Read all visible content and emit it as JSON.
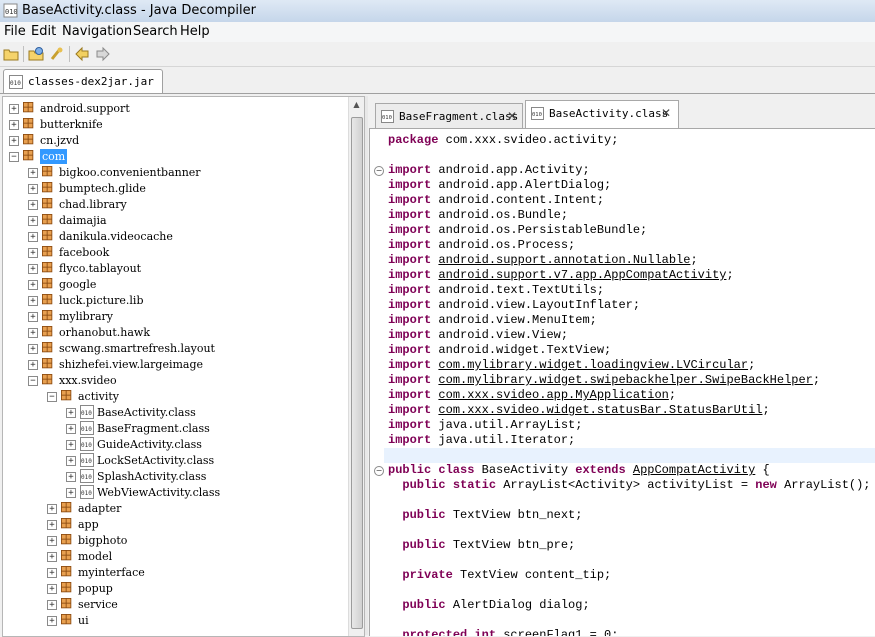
{
  "window": {
    "title": "BaseActivity.class - Java Decompiler"
  },
  "menu": [
    "File",
    "Edit",
    "Navigation",
    "Search",
    "Help"
  ],
  "file_tab": {
    "label": "classes-dex2jar.jar"
  },
  "tree": [
    {
      "label": "android.support",
      "depth": 0,
      "toggle": "+",
      "kind": "pkg"
    },
    {
      "label": "butterknife",
      "depth": 0,
      "toggle": "+",
      "kind": "pkg"
    },
    {
      "label": "cn.jzvd",
      "depth": 0,
      "toggle": "+",
      "kind": "pkg"
    },
    {
      "label": "com",
      "depth": 0,
      "toggle": "−",
      "kind": "pkg",
      "selected": true
    },
    {
      "label": "bigkoo.convenientbanner",
      "depth": 1,
      "toggle": "+",
      "kind": "pkg"
    },
    {
      "label": "bumptech.glide",
      "depth": 1,
      "toggle": "+",
      "kind": "pkg"
    },
    {
      "label": "chad.library",
      "depth": 1,
      "toggle": "+",
      "kind": "pkg"
    },
    {
      "label": "daimajia",
      "depth": 1,
      "toggle": "+",
      "kind": "pkg"
    },
    {
      "label": "danikula.videocache",
      "depth": 1,
      "toggle": "+",
      "kind": "pkg"
    },
    {
      "label": "facebook",
      "depth": 1,
      "toggle": "+",
      "kind": "pkg"
    },
    {
      "label": "flyco.tablayout",
      "depth": 1,
      "toggle": "+",
      "kind": "pkg"
    },
    {
      "label": "google",
      "depth": 1,
      "toggle": "+",
      "kind": "pkg"
    },
    {
      "label": "luck.picture.lib",
      "depth": 1,
      "toggle": "+",
      "kind": "pkg"
    },
    {
      "label": "mylibrary",
      "depth": 1,
      "toggle": "+",
      "kind": "pkg"
    },
    {
      "label": "orhanobut.hawk",
      "depth": 1,
      "toggle": "+",
      "kind": "pkg"
    },
    {
      "label": "scwang.smartrefresh.layout",
      "depth": 1,
      "toggle": "+",
      "kind": "pkg"
    },
    {
      "label": "shizhefei.view.largeimage",
      "depth": 1,
      "toggle": "+",
      "kind": "pkg"
    },
    {
      "label": "xxx.svideo",
      "depth": 1,
      "toggle": "−",
      "kind": "pkg"
    },
    {
      "label": "activity",
      "depth": 2,
      "toggle": "−",
      "kind": "pkg"
    },
    {
      "label": "BaseActivity.class",
      "depth": 3,
      "toggle": "+",
      "kind": "cls"
    },
    {
      "label": "BaseFragment.class",
      "depth": 3,
      "toggle": "+",
      "kind": "cls"
    },
    {
      "label": "GuideActivity.class",
      "depth": 3,
      "toggle": "+",
      "kind": "cls"
    },
    {
      "label": "LockSetActivity.class",
      "depth": 3,
      "toggle": "+",
      "kind": "cls"
    },
    {
      "label": "SplashActivity.class",
      "depth": 3,
      "toggle": "+",
      "kind": "cls"
    },
    {
      "label": "WebViewActivity.class",
      "depth": 3,
      "toggle": "+",
      "kind": "cls"
    },
    {
      "label": "adapter",
      "depth": 2,
      "toggle": "+",
      "kind": "pkg"
    },
    {
      "label": "app",
      "depth": 2,
      "toggle": "+",
      "kind": "pkg"
    },
    {
      "label": "bigphoto",
      "depth": 2,
      "toggle": "+",
      "kind": "pkg"
    },
    {
      "label": "model",
      "depth": 2,
      "toggle": "+",
      "kind": "pkg"
    },
    {
      "label": "myinterface",
      "depth": 2,
      "toggle": "+",
      "kind": "pkg"
    },
    {
      "label": "popup",
      "depth": 2,
      "toggle": "+",
      "kind": "pkg"
    },
    {
      "label": "service",
      "depth": 2,
      "toggle": "+",
      "kind": "pkg"
    },
    {
      "label": "ui",
      "depth": 2,
      "toggle": "+",
      "kind": "pkg"
    }
  ],
  "code_tabs": [
    {
      "label": "BaseFragment.class",
      "active": false
    },
    {
      "label": "BaseActivity.class",
      "active": true
    }
  ],
  "code": [
    {
      "line": 0,
      "parts": [
        [
          "kw",
          "package"
        ],
        [
          "t",
          " com.xxx.svideo.activity;"
        ]
      ]
    },
    {
      "line": 2,
      "fold": true,
      "parts": [
        [
          "kw",
          "import"
        ],
        [
          "t",
          " android.app.Activity;"
        ]
      ]
    },
    {
      "line": 3,
      "parts": [
        [
          "kw",
          "import"
        ],
        [
          "t",
          " android.app.AlertDialog;"
        ]
      ]
    },
    {
      "line": 4,
      "parts": [
        [
          "kw",
          "import"
        ],
        [
          "t",
          " android.content.Intent;"
        ]
      ]
    },
    {
      "line": 5,
      "parts": [
        [
          "kw",
          "import"
        ],
        [
          "t",
          " android.os.Bundle;"
        ]
      ]
    },
    {
      "line": 6,
      "parts": [
        [
          "kw",
          "import"
        ],
        [
          "t",
          " android.os.PersistableBundle;"
        ]
      ]
    },
    {
      "line": 7,
      "parts": [
        [
          "kw",
          "import"
        ],
        [
          "t",
          " android.os.Process;"
        ]
      ]
    },
    {
      "line": 8,
      "parts": [
        [
          "kw",
          "import"
        ],
        [
          "t",
          " "
        ],
        [
          "u",
          "android.support.annotation.Nullable"
        ],
        [
          "t",
          ";"
        ]
      ]
    },
    {
      "line": 9,
      "parts": [
        [
          "kw",
          "import"
        ],
        [
          "t",
          " "
        ],
        [
          "u",
          "android.support.v7.app.AppCompatActivity"
        ],
        [
          "t",
          ";"
        ]
      ]
    },
    {
      "line": 10,
      "parts": [
        [
          "kw",
          "import"
        ],
        [
          "t",
          " android.text.TextUtils;"
        ]
      ]
    },
    {
      "line": 11,
      "parts": [
        [
          "kw",
          "import"
        ],
        [
          "t",
          " android.view.LayoutInflater;"
        ]
      ]
    },
    {
      "line": 12,
      "parts": [
        [
          "kw",
          "import"
        ],
        [
          "t",
          " android.view.MenuItem;"
        ]
      ]
    },
    {
      "line": 13,
      "parts": [
        [
          "kw",
          "import"
        ],
        [
          "t",
          " android.view.View;"
        ]
      ]
    },
    {
      "line": 14,
      "parts": [
        [
          "kw",
          "import"
        ],
        [
          "t",
          " android.widget.TextView;"
        ]
      ]
    },
    {
      "line": 15,
      "parts": [
        [
          "kw",
          "import"
        ],
        [
          "t",
          " "
        ],
        [
          "u",
          "com.mylibrary.widget.loadingview.LVCircular"
        ],
        [
          "t",
          ";"
        ]
      ]
    },
    {
      "line": 16,
      "parts": [
        [
          "kw",
          "import"
        ],
        [
          "t",
          " "
        ],
        [
          "u",
          "com.mylibrary.widget.swipebackhelper.SwipeBackHelper"
        ],
        [
          "t",
          ";"
        ]
      ]
    },
    {
      "line": 17,
      "parts": [
        [
          "kw",
          "import"
        ],
        [
          "t",
          " "
        ],
        [
          "u",
          "com.xxx.svideo.app.MyApplication"
        ],
        [
          "t",
          ";"
        ]
      ]
    },
    {
      "line": 18,
      "parts": [
        [
          "kw",
          "import"
        ],
        [
          "t",
          " "
        ],
        [
          "u",
          "com.xxx.svideo.widget.statusBar.StatusBarUtil"
        ],
        [
          "t",
          ";"
        ]
      ]
    },
    {
      "line": 19,
      "parts": [
        [
          "kw",
          "import"
        ],
        [
          "t",
          " java.util.ArrayList;"
        ]
      ]
    },
    {
      "line": 20,
      "parts": [
        [
          "kw",
          "import"
        ],
        [
          "t",
          " java.util.Iterator;"
        ]
      ]
    },
    {
      "line": 22,
      "fold": true,
      "parts": [
        [
          "kw",
          "public class"
        ],
        [
          "t",
          " BaseActivity "
        ],
        [
          "kw",
          "extends"
        ],
        [
          "t",
          " "
        ],
        [
          "u",
          "AppCompatActivity"
        ],
        [
          "t",
          " {"
        ]
      ]
    },
    {
      "line": 23,
      "parts": [
        [
          "t",
          "  "
        ],
        [
          "kw",
          "public static"
        ],
        [
          "t",
          " ArrayList<Activity> activityList = "
        ],
        [
          "kw",
          "new"
        ],
        [
          "t",
          " ArrayList();"
        ]
      ]
    },
    {
      "line": 25,
      "parts": [
        [
          "t",
          "  "
        ],
        [
          "kw",
          "public"
        ],
        [
          "t",
          " TextView btn_next;"
        ]
      ]
    },
    {
      "line": 27,
      "parts": [
        [
          "t",
          "  "
        ],
        [
          "kw",
          "public"
        ],
        [
          "t",
          " TextView btn_pre;"
        ]
      ]
    },
    {
      "line": 29,
      "parts": [
        [
          "t",
          "  "
        ],
        [
          "kw",
          "private"
        ],
        [
          "t",
          " TextView content_tip;"
        ]
      ]
    },
    {
      "line": 31,
      "parts": [
        [
          "t",
          "  "
        ],
        [
          "kw",
          "public"
        ],
        [
          "t",
          " AlertDialog dialog;"
        ]
      ]
    },
    {
      "line": 33,
      "parts": [
        [
          "t",
          "  "
        ],
        [
          "kw",
          "protected int"
        ],
        [
          "t",
          " screenFlag1 = 0;"
        ]
      ]
    }
  ],
  "highlighted_line": 21
}
